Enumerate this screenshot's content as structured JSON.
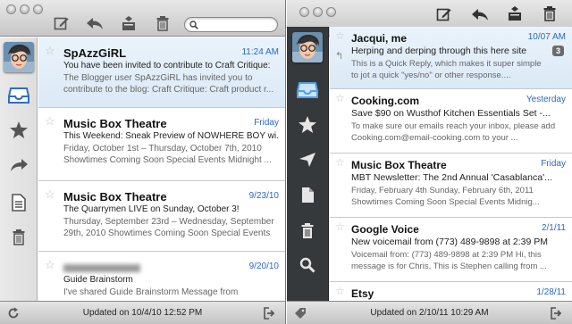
{
  "left": {
    "search": {
      "placeholder": ""
    },
    "messages": [
      {
        "sender": "SpAzzGiRL",
        "date": "11:24 AM",
        "subject": "You have been invited to contribute to Craft Critique:",
        "preview": "The Blogger user SpAzzGiRL has invited you to contribute to the blog: Craft Critique: Craft product r..."
      },
      {
        "sender": "Music Box Theatre",
        "date": "Friday",
        "subject": "This Weekend: Sneak Preview of NOWHERE BOY wi...",
        "preview": "Friday, October 1st – Thursday, October 7th, 2010 Showtimes Coming Soon Special Events Midnight ..."
      },
      {
        "sender": "Music Box Theatre",
        "date": "9/23/10",
        "subject": "The Quarrymen LIVE on Sunday, October 3!",
        "preview": "Thursday, September 23rd – Wednesday, September 29th, 2010 Showtimes Coming Soon Special Events ..."
      },
      {
        "sender": "",
        "date": "9/20/10",
        "subject": "Guide Brainstorm",
        "preview": "I've shared Guide Brainstorm Message from"
      }
    ],
    "status": "Updated on 10/4/10 12:52 PM"
  },
  "right": {
    "messages": [
      {
        "sender": "Jacqui, me",
        "date": "10/07 AM",
        "subject": "Herping and derping through this here site",
        "preview": "This is a Quick Reply, which makes it super simple to jot a quick \"yes/no\" or other response....",
        "count": "3"
      },
      {
        "sender": "Cooking.com",
        "date": "Yesterday",
        "subject": "Save $90 on Wusthof Kitchen Essentials Set -...",
        "preview": "To make sure our emails reach your inbox, please add Cooking.com@email-cooking.com to your ..."
      },
      {
        "sender": "Music Box Theatre",
        "date": "Friday",
        "subject": "MBT Newsletter: The 2nd Annual 'Casablanca'...",
        "preview": "Friday, February 4th Sunday, February 6th, 2011 Showtimes Coming Soon Special Events Midnig..."
      },
      {
        "sender": "Google Voice",
        "date": "2/1/11",
        "subject": "New voicemail from (773) 489-9898 at 2:39 PM",
        "preview": "Voicemail from: (773) 489-9898 at 2:39 PM Hi, this message is for Chris, This is Stephen calling from ..."
      },
      {
        "sender": "Etsy",
        "date": "1/28/11",
        "subject": "",
        "preview": ""
      }
    ],
    "status": "Updated on 2/10/11 10:29 AM"
  },
  "icons": {
    "toolbar": [
      "compose-icon",
      "reply-icon",
      "archive-icon",
      "trash-icon"
    ],
    "left_sidebar": [
      "inbox-icon",
      "star-icon",
      "forward-icon",
      "document-icon",
      "trash-icon"
    ],
    "right_sidebar": [
      "inbox-icon",
      "star-icon",
      "send-icon",
      "document-icon",
      "trash-icon",
      "search-icon"
    ],
    "status": [
      "refresh-icon",
      "logout-icon",
      "tag-icon"
    ]
  },
  "colors": {
    "accent": "#2b67c9",
    "dark_sidebar": "#36393c",
    "selected_row": "#dbe9f6"
  }
}
